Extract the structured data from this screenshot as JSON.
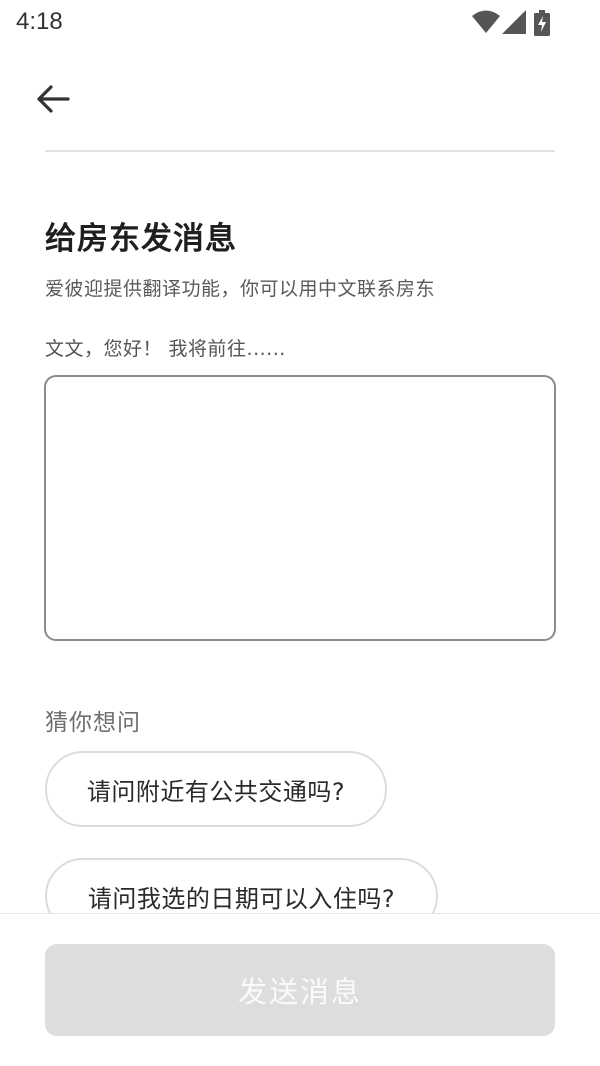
{
  "status_bar": {
    "time": "4:18",
    "icons": [
      "wifi-icon",
      "cellular-signal-icon",
      "battery-charging-icon"
    ]
  },
  "nav": {
    "back_icon": "arrow-left-icon"
  },
  "content": {
    "title": "给房东发消息",
    "subtitle": "爱彼迎提供翻译功能，你可以用中文联系房东",
    "message_hint": "文文，您好！ 我将前往......",
    "message_value": ""
  },
  "suggestions": {
    "heading": "猜你想问",
    "items": [
      "请问附近有公共交通吗?",
      "请问我选的日期可以入住吗?"
    ]
  },
  "footer": {
    "send_label": "发送消息"
  },
  "colors": {
    "send_disabled_bg": "#dddddd",
    "send_disabled_text": "#fafafa",
    "border": "#8c8c8c",
    "chip_border": "#dcdcdc"
  }
}
